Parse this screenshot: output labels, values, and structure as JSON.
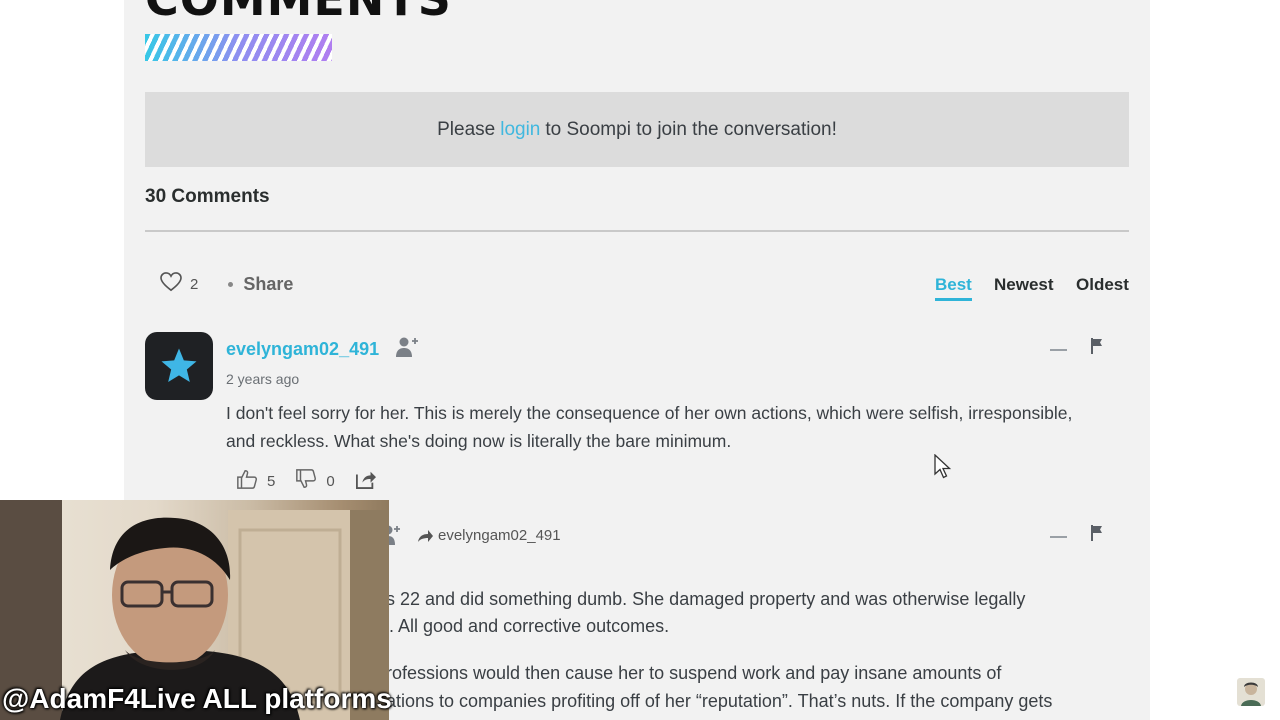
{
  "section": {
    "heading": "COMMENTS"
  },
  "login_prompt": {
    "prefix": "Please",
    "link": "login",
    "suffix": "to Soompi to join the conversation!"
  },
  "comments_count": "30 Comments",
  "toolbar": {
    "likes": "2",
    "share_label": "Share"
  },
  "sort": {
    "options": [
      "Best",
      "Newest",
      "Oldest"
    ],
    "active": "Best"
  },
  "comment1": {
    "username": "evelyngam02_491",
    "time": "2 years ago",
    "text": "I don't feel sorry for her. This is merely the consequence of her own actions, which were selfish, irresponsible, and reckless. What she's doing now is literally the bare minimum.",
    "upvotes": "5",
    "downvotes": "0"
  },
  "comment2": {
    "reply_to": "evelyngam02_491",
    "lines": [
      "s 22 and did something dumb. She damaged property and was otherwise legally",
      ". All good and corrective outcomes.",
      "rofessions would then cause her to suspend work and pay insane amounts of",
      "ations to companies profiting off of her “reputation”. That’s nuts. If the company gets"
    ]
  },
  "overlay": {
    "watermark": "@AdamF4Live ALL platforms"
  },
  "colors": {
    "accent": "#2fb4d8",
    "panel": "#f2f2f2",
    "login_bg": "#dcdcdc"
  },
  "icons": [
    "heart-icon",
    "add-user-icon",
    "minus-icon",
    "flag-icon",
    "thumbs-up-icon",
    "thumbs-down-icon",
    "share-icon",
    "reply-arrow-icon",
    "star-icon",
    "cursor-icon"
  ]
}
